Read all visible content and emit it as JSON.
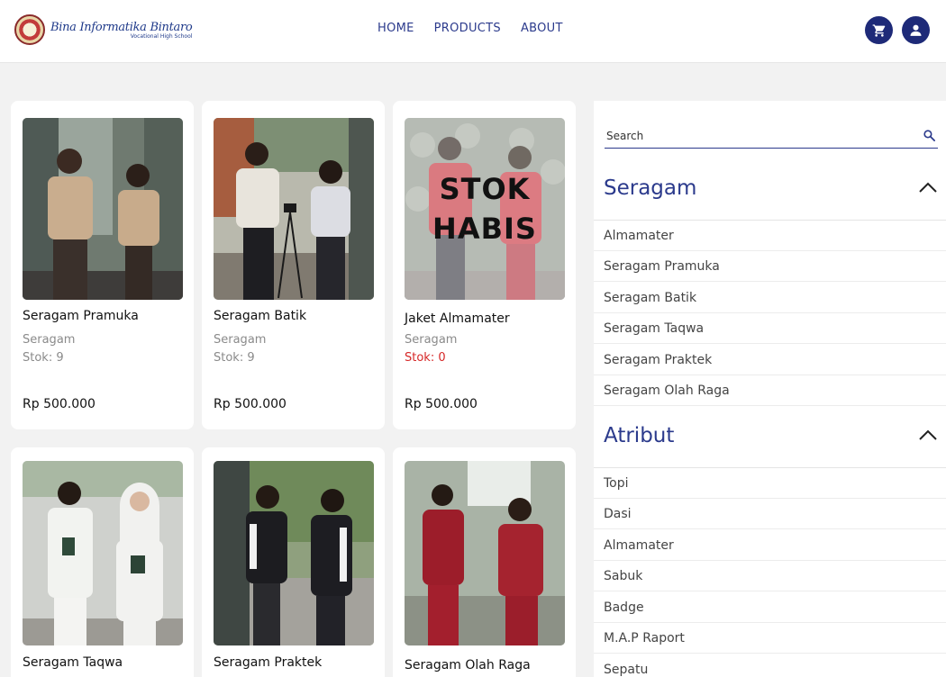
{
  "header": {
    "logo": {
      "name": "Bina Informatika Bintaro",
      "subtitle": "Vocational High School"
    },
    "nav": [
      {
        "label": "HOME"
      },
      {
        "label": "PRODUCTS"
      },
      {
        "label": "ABOUT"
      }
    ],
    "icons": {
      "cart": "cart-icon",
      "user": "user-icon"
    },
    "accent": "#1e2a78"
  },
  "products": [
    {
      "name": "Seragam Pramuka",
      "category": "Seragam",
      "stock": "Stok: 9",
      "price": "Rp 500.000",
      "photo": "scout-uniform-photo"
    },
    {
      "name": "Seragam Batik",
      "category": "Seragam",
      "stock": "Stok: 9",
      "price": "Rp 500.000",
      "photo": "batik-uniform-photo"
    },
    {
      "name": "Jaket Almamater",
      "category": "Seragam",
      "stock": "Stok: 0",
      "price": "Rp 500.000",
      "photo": "almamater-jacket-photo",
      "overlay": "STOK HABIS"
    },
    {
      "name": "Seragam Taqwa",
      "photo": "taqwa-uniform-photo"
    },
    {
      "name": "Seragam Praktek",
      "photo": "praktek-uniform-photo"
    },
    {
      "name": "Seragam Olah Raga",
      "photo": "sports-uniform-photo"
    }
  ],
  "sidebar": {
    "search": {
      "placeholder": "Search",
      "value": ""
    },
    "sections": [
      {
        "title": "Seragam",
        "items": [
          {
            "label": "Almamater"
          },
          {
            "label": "Seragam Pramuka"
          },
          {
            "label": "Seragam Batik"
          },
          {
            "label": "Seragam Taqwa"
          },
          {
            "label": "Seragam Praktek"
          },
          {
            "label": "Seragam Olah Raga"
          }
        ]
      },
      {
        "title": "Atribut",
        "items": [
          {
            "label": "Topi"
          },
          {
            "label": "Dasi"
          },
          {
            "label": "Almamater"
          },
          {
            "label": "Sabuk"
          },
          {
            "label": "Badge"
          },
          {
            "label": "M.A.P Raport"
          },
          {
            "label": "Sepatu"
          }
        ]
      }
    ]
  }
}
